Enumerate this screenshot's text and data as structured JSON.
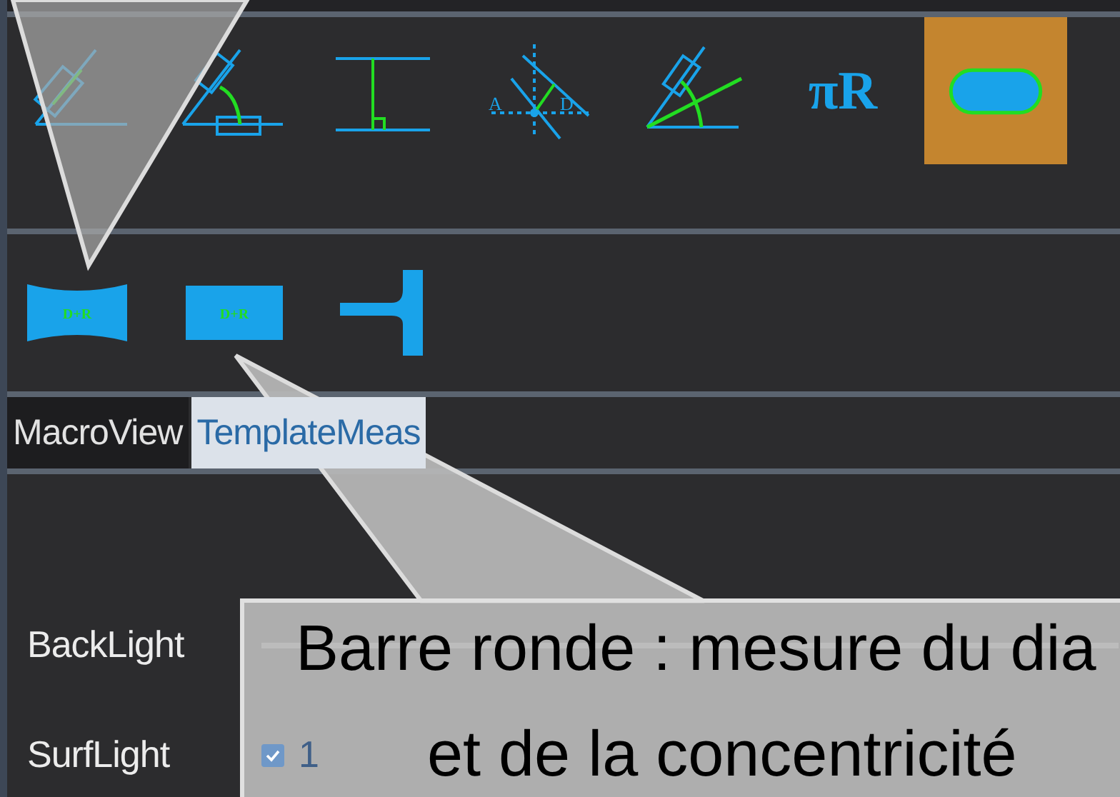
{
  "toolbar_1": {
    "tools": [
      {
        "kind": "angle-line",
        "selected": false
      },
      {
        "kind": "angle-arc",
        "selected": false
      },
      {
        "kind": "perpendicular",
        "selected": false
      },
      {
        "kind": "point-line",
        "labels": [
          "A",
          "D"
        ],
        "selected": false
      },
      {
        "kind": "angle-two-lines",
        "selected": false
      },
      {
        "kind": "text",
        "label": "πR",
        "selected": false
      },
      {
        "kind": "round-bar",
        "selected": true
      }
    ]
  },
  "toolbar_2": {
    "tools": [
      {
        "kind": "waisted-bar",
        "label": "D+R"
      },
      {
        "kind": "rect-bar",
        "label": "D+R"
      },
      {
        "kind": "t-profile"
      }
    ]
  },
  "tabs": [
    {
      "label": "MacroView",
      "selected": false
    },
    {
      "label": "TemplateMeas",
      "selected": true
    }
  ],
  "lights": [
    {
      "kind": "slider",
      "label": "BackLight"
    },
    {
      "kind": "checks",
      "label": "SurfLight",
      "options": [
        {
          "label": "1",
          "checked": true
        }
      ]
    }
  ],
  "callouts": [
    {
      "kind": "pointer"
    },
    {
      "kind": "tooltip",
      "lines": [
        "Barre ronde : mesure du dia",
        "et de la concentricité"
      ]
    }
  ]
}
